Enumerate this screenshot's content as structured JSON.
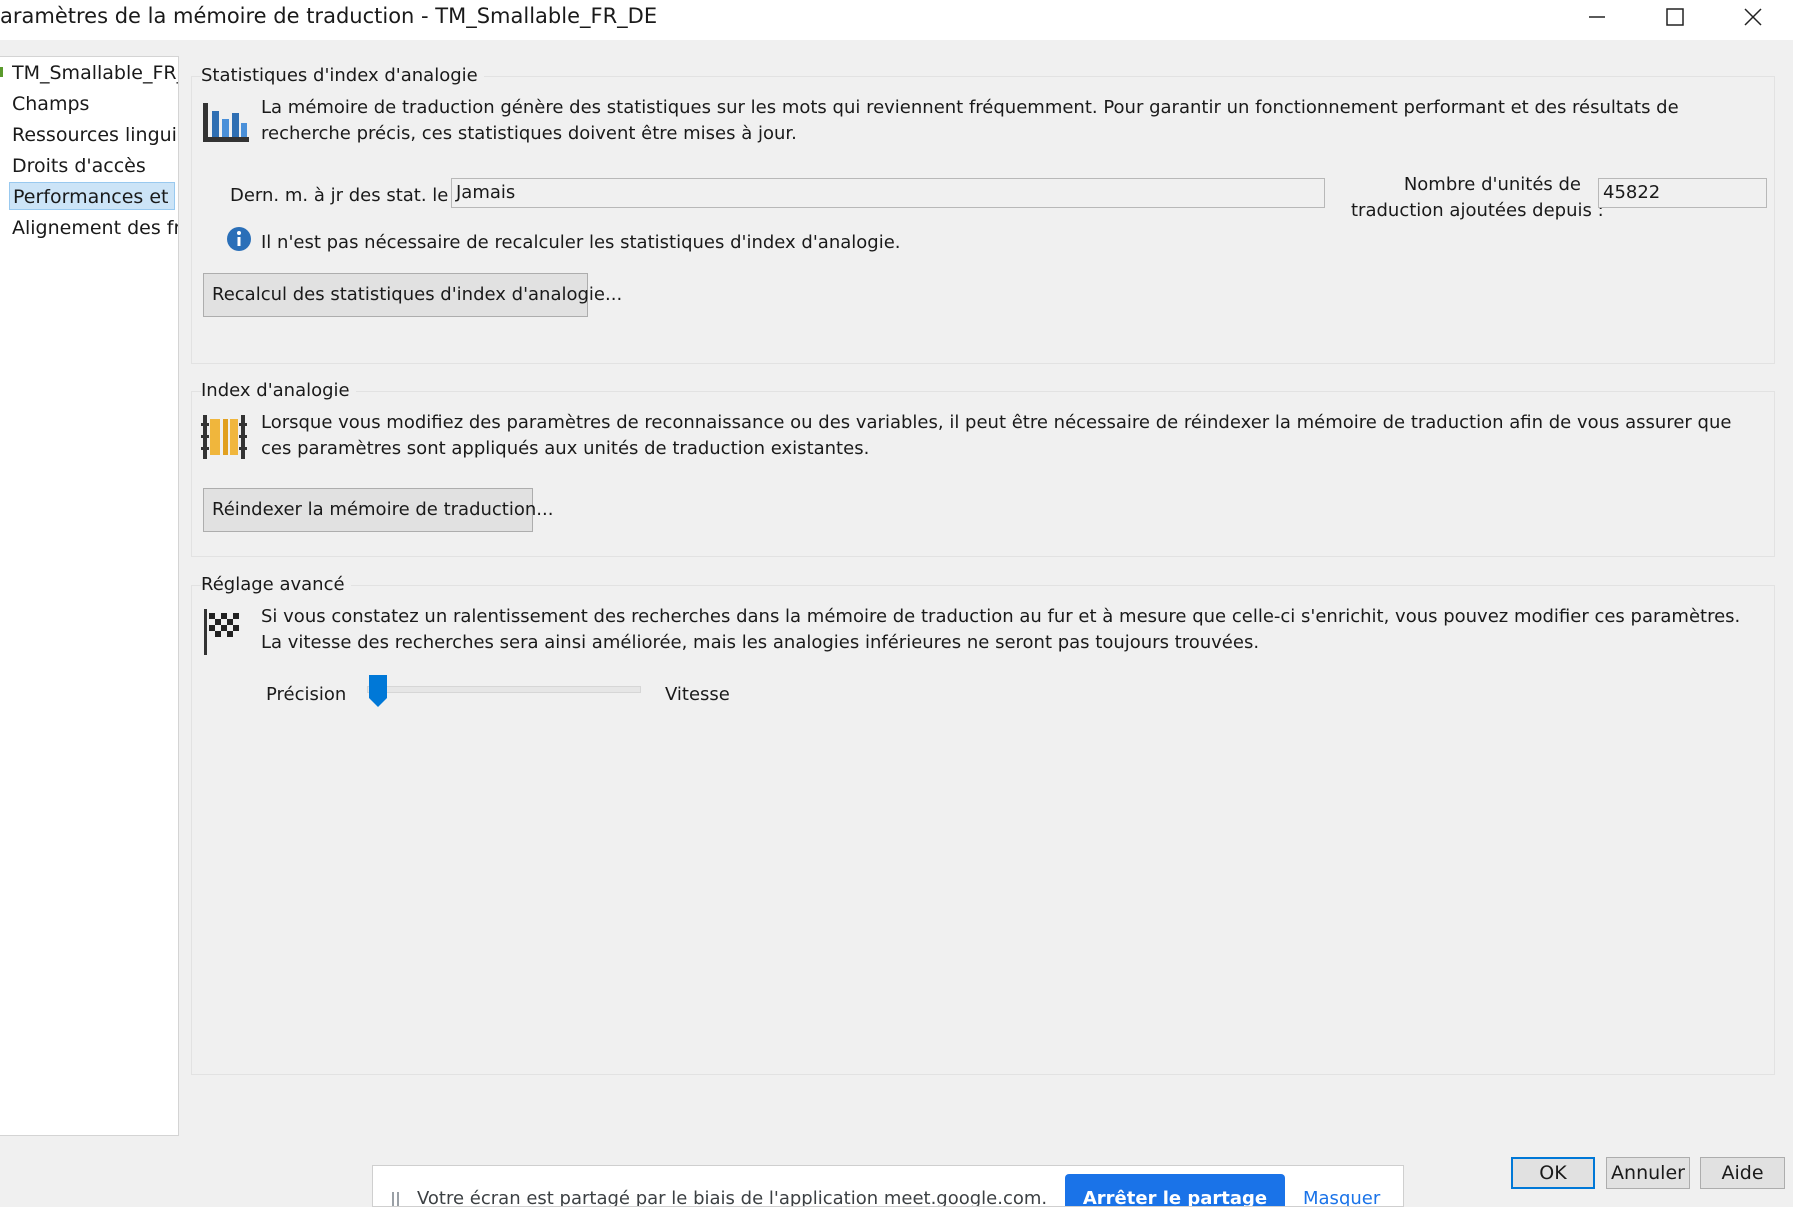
{
  "window": {
    "title": "aramètres de la mémoire de traduction - TM_Smallable_FR_DE",
    "minimize": "—",
    "maximize": "☐",
    "close": "✕"
  },
  "nav": {
    "items": [
      {
        "label": "TM_Smallable_FR_"
      },
      {
        "label": "Champs"
      },
      {
        "label": "Ressources linguist"
      },
      {
        "label": "Droits d'accès"
      },
      {
        "label": "Performances et ré"
      },
      {
        "label": "Alignement des fra"
      }
    ],
    "selected_index": 4
  },
  "stats": {
    "title": "Statistiques d'index d'analogie",
    "description": "La mémoire de traduction génère des statistiques sur les mots qui reviennent fréquemment. Pour garantir un fonctionnement performant et des résultats de recherche précis, ces statistiques doivent être mises à jour.",
    "last_update_label": "Dern. m. à jr des stat. le :",
    "last_update_value": "Jamais",
    "units_label_line1": "Nombre d'unités de",
    "units_label_line2": "traduction ajoutées depuis :",
    "units_value": "45822",
    "info_text": "Il n'est pas nécessaire de recalculer les statistiques d'index d'analogie.",
    "recalc_button": "Recalcul des statistiques d'index d'analogie..."
  },
  "reindex": {
    "title": "Index d'analogie",
    "description": "Lorsque vous modifiez des paramètres de reconnaissance ou des variables, il peut être nécessaire de réindexer la mémoire de traduction afin de vous assurer que ces paramètres sont appliqués aux unités de traduction existantes.",
    "button": "Réindexer la mémoire de traduction..."
  },
  "tuning": {
    "title": "Réglage avancé",
    "description": "Si vous constatez un ralentissement des recherches dans la mémoire de traduction au fur et à mesure que celle-ci s'enrichit, vous pouvez modifier ces paramètres. La vitesse des recherches sera ainsi améliorée, mais les analogies inférieures ne seront pas toujours trouvées.",
    "slider_left_label": "Précision",
    "slider_right_label": "Vitesse",
    "slider_value": 0
  },
  "footer": {
    "ok": "OK",
    "cancel": "Annuler",
    "help": "Aide"
  },
  "share_bar": {
    "message": "Votre écran est partagé par le biais de l'application meet.google.com.",
    "stop_button": "Arrêter le partage",
    "hide_link": "Masquer"
  },
  "colors": {
    "accent": "#0078d7",
    "selection": "#cce4f7",
    "share_blue": "#1a73e8"
  }
}
